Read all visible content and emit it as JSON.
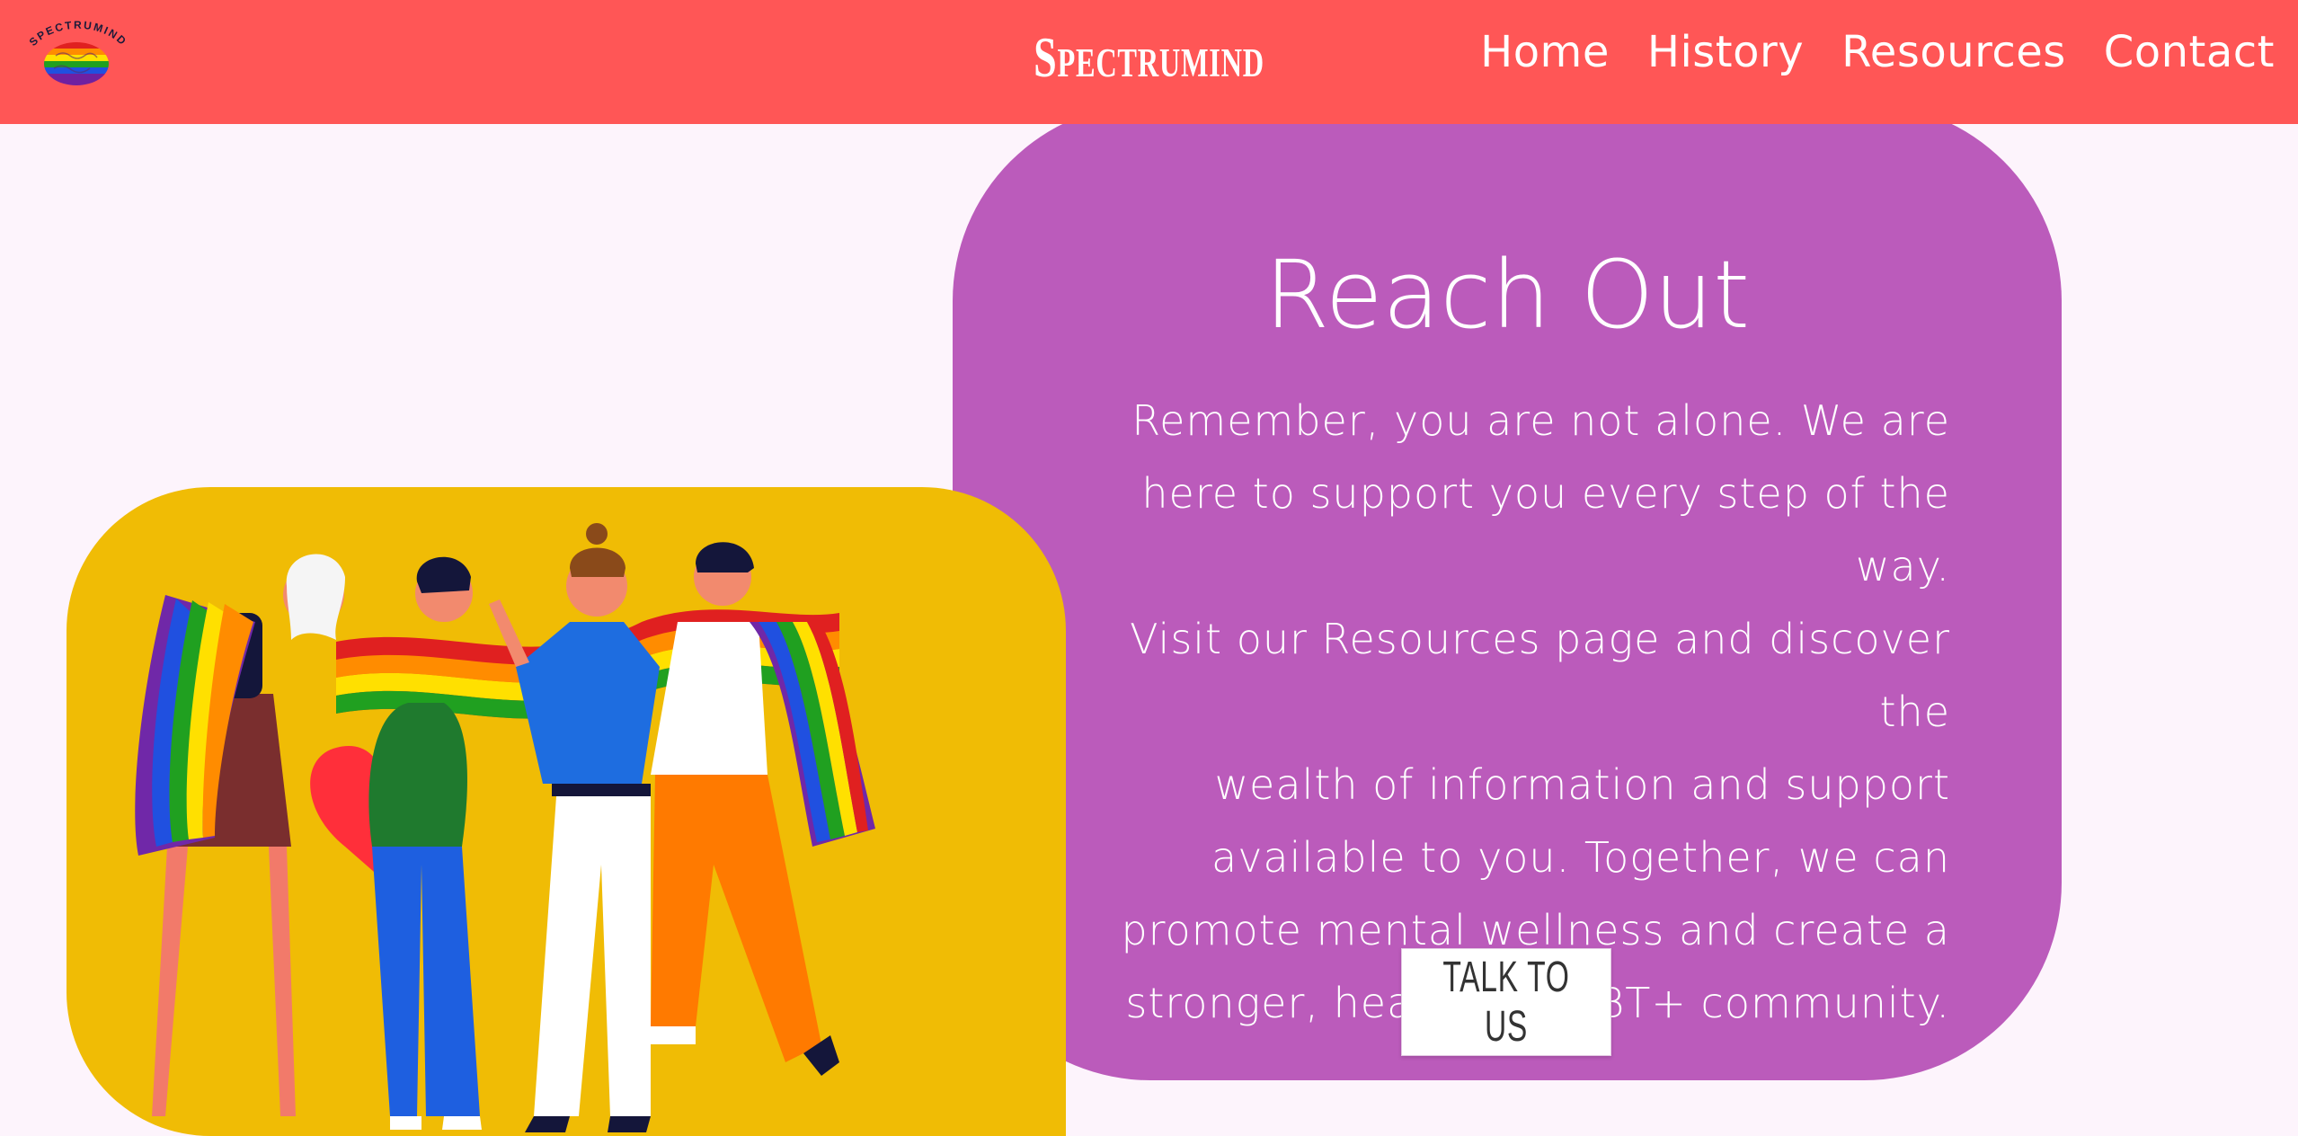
{
  "header": {
    "logo_text": "SPECTRUMIND",
    "brand": "Spectrumind",
    "nav": [
      "Home",
      "History",
      "Resources",
      "Contact"
    ]
  },
  "main": {
    "title": "Reach Out",
    "body_lines": [
      "Remember, you are not alone. We are",
      "here to support you every step of the way.",
      "Visit our Resources page and discover the",
      "wealth of information and support",
      "available to you. Together, we can",
      "promote mental wellness and create a",
      "stronger, healthier LGBT+ community."
    ],
    "cta_label": "TALK TO US",
    "illustration": "pride-group-illustration"
  },
  "colors": {
    "header": "#ff5656",
    "page_bg": "#fdf4fc",
    "card": "#bb5bbb",
    "illustration_bg": "#f0bc05",
    "text_light": "#ffffff"
  }
}
